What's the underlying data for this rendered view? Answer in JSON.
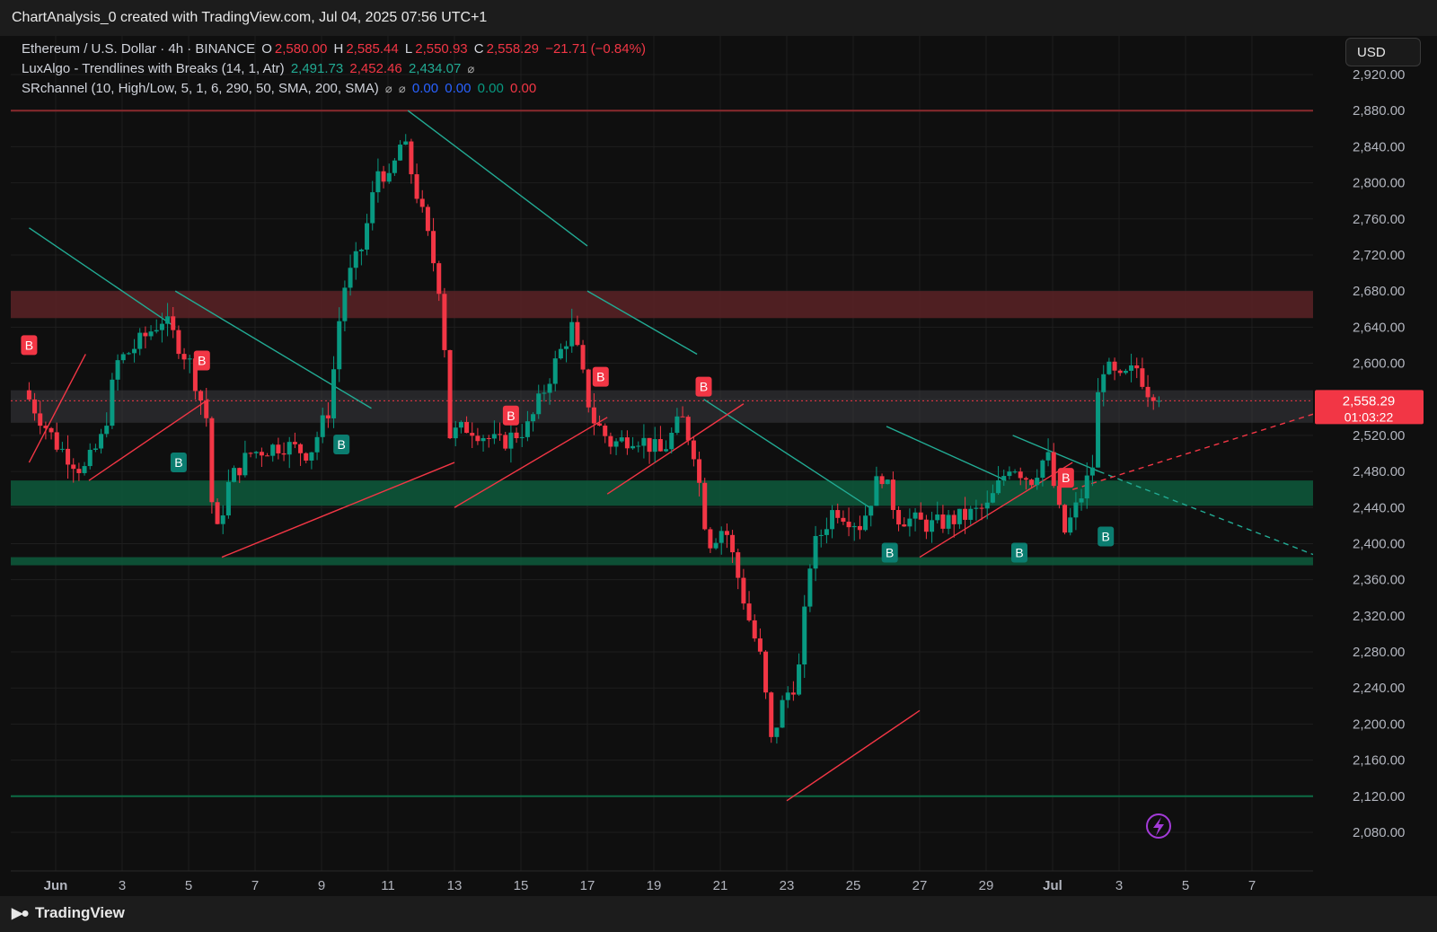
{
  "header": {
    "title": "ChartAnalysis_0 created with TradingView.com, Jul 04, 2025 07:56 UTC+1"
  },
  "legend": {
    "symbol": "Ethereum / U.S. Dollar · 4h · BINANCE",
    "ohlc": {
      "o_label": "O",
      "o": "2,580.00",
      "h_label": "H",
      "h": "2,585.44",
      "l_label": "L",
      "l": "2,550.93",
      "c_label": "C",
      "c": "2,558.29",
      "change": "−21.71 (−0.84%)"
    },
    "luxalgo": {
      "label": "LuxAlgo - Trendlines with Breaks (14, 1, Atr)",
      "v1": "2,491.73",
      "v2": "2,452.46",
      "v3": "2,434.07"
    },
    "srchannel": {
      "label": "SRchannel (10, High/Low, 5, 1, 6, 290, 50, SMA, 200, SMA)",
      "v1": "0.00",
      "v2": "0.00",
      "v3": "0.00",
      "v4": "0.00"
    }
  },
  "currency": "USD",
  "price_badge": {
    "price": "2,558.29",
    "countdown": "01:03:22"
  },
  "footer": {
    "brand": "TradingView"
  },
  "colors": {
    "up": "#089981",
    "down": "#f23645",
    "trend_down": "#22ab94",
    "trend_up": "#f23645",
    "resistance_zone": "#5a2226",
    "support_zone": "#0d5a3c",
    "current_zone": "#3a3b3f"
  },
  "chart_data": {
    "type": "candlestick",
    "title": "Ethereum / U.S. Dollar · 4h · BINANCE",
    "ylim": [
      2060,
      2950
    ],
    "y_ticks": [
      2920,
      2880,
      2840,
      2800,
      2760,
      2720,
      2680,
      2640,
      2600,
      2560,
      2520,
      2480,
      2440,
      2400,
      2360,
      2320,
      2280,
      2240,
      2200,
      2160,
      2120,
      2080
    ],
    "y_tick_labels": [
      "2,920.00",
      "2,880.00",
      "2,840.00",
      "2,800.00",
      "2,760.00",
      "2,720.00",
      "2,680.00",
      "2,640.00",
      "2,600.00",
      "",
      "2,520.00",
      "2,480.00",
      "2,440.00",
      "2,400.00",
      "2,360.00",
      "2,320.00",
      "2,280.00",
      "2,240.00",
      "2,200.00",
      "2,160.00",
      "2,120.00",
      "2,080.00"
    ],
    "x_ticks": [
      {
        "day": 1,
        "label": "Jun",
        "bold": true
      },
      {
        "day": 3,
        "label": "3"
      },
      {
        "day": 5,
        "label": "5"
      },
      {
        "day": 7,
        "label": "7"
      },
      {
        "day": 9,
        "label": "9"
      },
      {
        "day": 11,
        "label": "11"
      },
      {
        "day": 13,
        "label": "13"
      },
      {
        "day": 15,
        "label": "15"
      },
      {
        "day": 17,
        "label": "17"
      },
      {
        "day": 19,
        "label": "19"
      },
      {
        "day": 21,
        "label": "21"
      },
      {
        "day": 23,
        "label": "23"
      },
      {
        "day": 25,
        "label": "25"
      },
      {
        "day": 27,
        "label": "27"
      },
      {
        "day": 29,
        "label": "29"
      },
      {
        "day": 31,
        "label": "Jul",
        "bold": true
      },
      {
        "day": 33,
        "label": "3"
      },
      {
        "day": 35,
        "label": "5"
      },
      {
        "day": 37,
        "label": "7"
      }
    ],
    "x_domain_days": [
      0.2,
      39.5
    ],
    "anchors": [
      [
        0.2,
        2570
      ],
      [
        1.2,
        2510
      ],
      [
        2.0,
        2480
      ],
      [
        2.6,
        2520
      ],
      [
        3.0,
        2600
      ],
      [
        3.6,
        2620
      ],
      [
        4.4,
        2650
      ],
      [
        5.2,
        2600
      ],
      [
        5.7,
        2540
      ],
      [
        5.95,
        2400
      ],
      [
        6.4,
        2470
      ],
      [
        7.0,
        2500
      ],
      [
        8.0,
        2510
      ],
      [
        8.8,
        2500
      ],
      [
        9.4,
        2550
      ],
      [
        9.8,
        2680
      ],
      [
        10.4,
        2730
      ],
      [
        10.9,
        2820
      ],
      [
        11.2,
        2800
      ],
      [
        11.6,
        2850
      ],
      [
        12.3,
        2750
      ],
      [
        12.8,
        2670
      ],
      [
        13.0,
        2520
      ],
      [
        13.6,
        2530
      ],
      [
        14.5,
        2510
      ],
      [
        15.4,
        2530
      ],
      [
        16.2,
        2600
      ],
      [
        16.7,
        2640
      ],
      [
        17.3,
        2540
      ],
      [
        17.9,
        2510
      ],
      [
        18.6,
        2520
      ],
      [
        19.4,
        2500
      ],
      [
        20.0,
        2540
      ],
      [
        20.4,
        2500
      ],
      [
        20.8,
        2400
      ],
      [
        21.3,
        2420
      ],
      [
        22.0,
        2320
      ],
      [
        22.4,
        2270
      ],
      [
        22.7,
        2180
      ],
      [
        23.1,
        2230
      ],
      [
        23.5,
        2250
      ],
      [
        23.9,
        2390
      ],
      [
        24.6,
        2440
      ],
      [
        25.4,
        2420
      ],
      [
        26.0,
        2480
      ],
      [
        26.5,
        2430
      ],
      [
        27.5,
        2420
      ],
      [
        28.5,
        2430
      ],
      [
        29.2,
        2440
      ],
      [
        29.9,
        2490
      ],
      [
        30.5,
        2470
      ],
      [
        31.0,
        2500
      ],
      [
        31.5,
        2410
      ],
      [
        32.0,
        2450
      ],
      [
        32.4,
        2490
      ],
      [
        32.6,
        2600
      ],
      [
        33.2,
        2580
      ],
      [
        33.7,
        2595
      ],
      [
        34.2,
        2558
      ]
    ],
    "last_close": 2558.29,
    "zones": [
      {
        "name": "resistance-zone",
        "from": 2650,
        "to": 2680,
        "color": "#5a2226"
      },
      {
        "name": "current-price-zone",
        "from": 2534,
        "to": 2570,
        "color": "#3a3b3f"
      },
      {
        "name": "support-zone",
        "from": 2442,
        "to": 2470,
        "color": "#0d5a3c"
      },
      {
        "name": "lower-support-zone",
        "from": 2376,
        "to": 2385,
        "color": "#0d5a3c"
      }
    ],
    "levels": [
      {
        "name": "top-resistance-line",
        "value": 2880,
        "color": "#8a2a2e"
      },
      {
        "name": "bottom-support-line",
        "value": 2120,
        "color": "#0d6b45"
      }
    ],
    "trendlines_down": [
      [
        0.2,
        2750,
        4.6,
        2640
      ],
      [
        4.6,
        2680,
        10.5,
        2550
      ],
      [
        11.6,
        2880,
        17.0,
        2730
      ],
      [
        17.0,
        2680,
        20.3,
        2610
      ],
      [
        20.5,
        2560,
        25.5,
        2440
      ],
      [
        26.0,
        2530,
        29.6,
        2470
      ],
      [
        29.8,
        2520,
        32.4,
        2480
      ]
    ],
    "trendlines_down_dashed": [
      [
        32.4,
        2480,
        39.4,
        2380
      ]
    ],
    "trendlines_up": [
      [
        0.2,
        2490,
        1.9,
        2610
      ],
      [
        2.0,
        2470,
        5.6,
        2560
      ],
      [
        6.0,
        2385,
        13.0,
        2490
      ],
      [
        13.0,
        2440,
        17.6,
        2540
      ],
      [
        17.6,
        2455,
        21.7,
        2555
      ],
      [
        23.0,
        2115,
        27.0,
        2215
      ],
      [
        27.0,
        2385,
        31.6,
        2490
      ]
    ],
    "trendlines_up_dashed": [
      [
        31.6,
        2460,
        39.4,
        2550
      ]
    ],
    "break_signals": [
      {
        "label": "B",
        "kind": "bull",
        "day": 4.7,
        "price": 2490
      },
      {
        "label": "B",
        "kind": "bull",
        "day": 9.6,
        "price": 2510
      },
      {
        "label": "B",
        "kind": "bull",
        "day": 26.1,
        "price": 2390
      },
      {
        "label": "B",
        "kind": "bull",
        "day": 30.0,
        "price": 2390
      },
      {
        "label": "B",
        "kind": "bull",
        "day": 32.6,
        "price": 2408
      },
      {
        "label": "B",
        "kind": "bear",
        "day": 0.2,
        "price": 2620
      },
      {
        "label": "B",
        "kind": "bear",
        "day": 5.4,
        "price": 2603
      },
      {
        "label": "B",
        "kind": "bear",
        "day": 14.7,
        "price": 2542
      },
      {
        "label": "B",
        "kind": "bear",
        "day": 17.4,
        "price": 2585
      },
      {
        "label": "B",
        "kind": "bear",
        "day": 20.5,
        "price": 2574
      },
      {
        "label": "B",
        "kind": "bear",
        "day": 31.4,
        "price": 2473
      }
    ]
  }
}
